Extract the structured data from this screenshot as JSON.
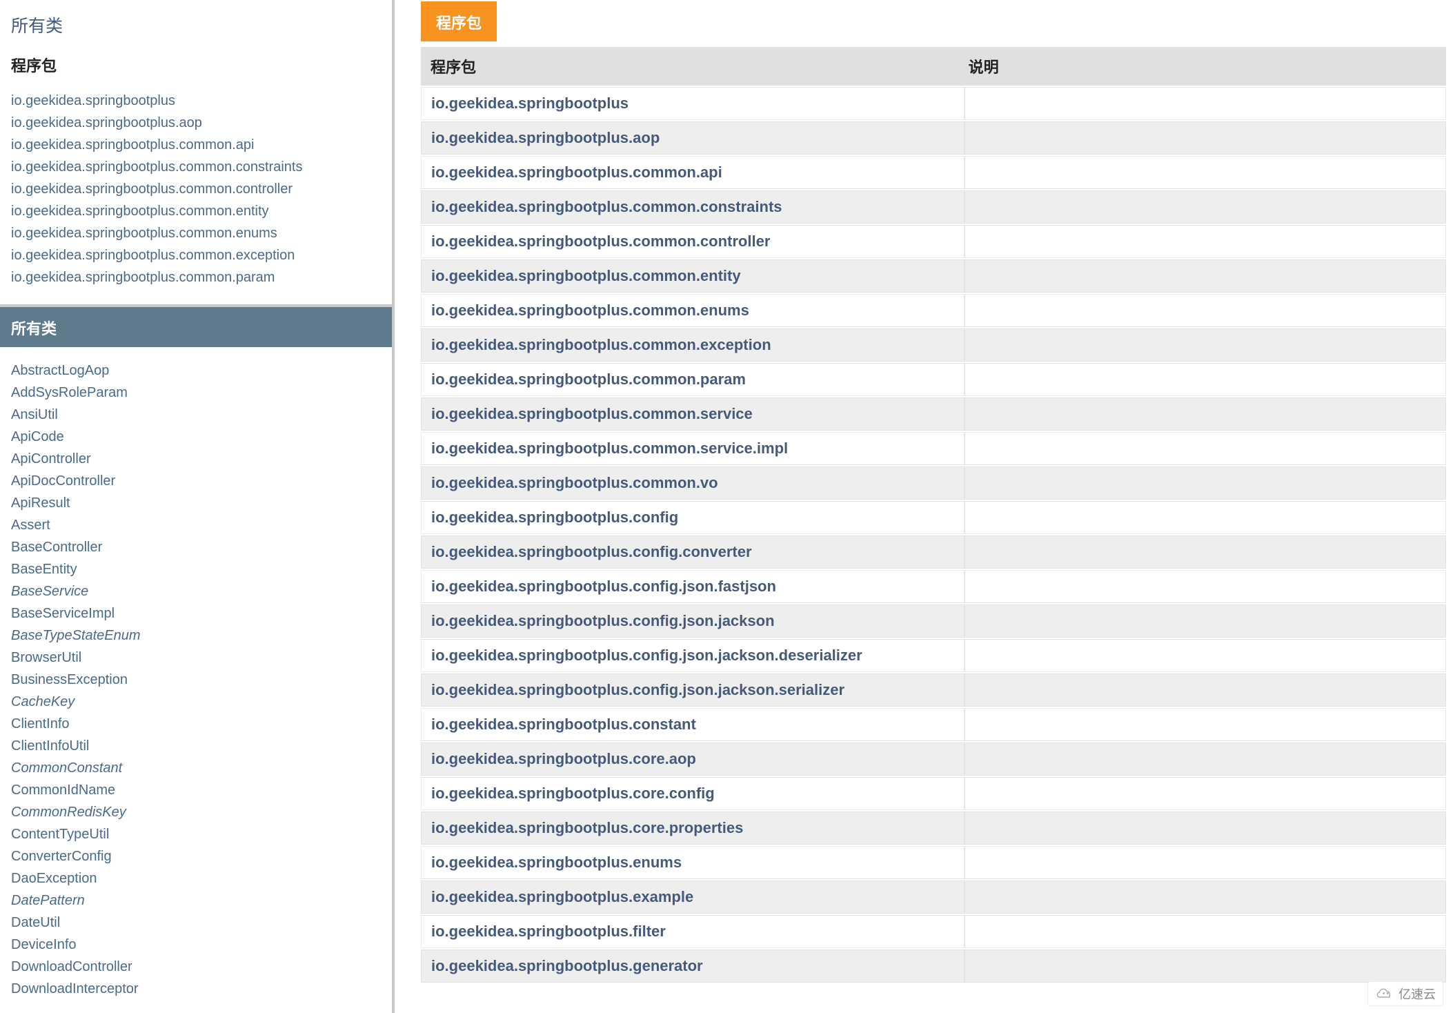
{
  "sidebar": {
    "all_classes_link": "所有类",
    "packages_heading": "程序包",
    "packages": [
      "io.geekidea.springbootplus",
      "io.geekidea.springbootplus.aop",
      "io.geekidea.springbootplus.common.api",
      "io.geekidea.springbootplus.common.constraints",
      "io.geekidea.springbootplus.common.controller",
      "io.geekidea.springbootplus.common.entity",
      "io.geekidea.springbootplus.common.enums",
      "io.geekidea.springbootplus.common.exception",
      "io.geekidea.springbootplus.common.param"
    ],
    "all_classes_bar": "所有类",
    "classes": [
      {
        "name": "AbstractLogAop",
        "italic": false
      },
      {
        "name": "AddSysRoleParam",
        "italic": false
      },
      {
        "name": "AnsiUtil",
        "italic": false
      },
      {
        "name": "ApiCode",
        "italic": false
      },
      {
        "name": "ApiController",
        "italic": false
      },
      {
        "name": "ApiDocController",
        "italic": false
      },
      {
        "name": "ApiResult",
        "italic": false
      },
      {
        "name": "Assert",
        "italic": false
      },
      {
        "name": "BaseController",
        "italic": false
      },
      {
        "name": "BaseEntity",
        "italic": false
      },
      {
        "name": "BaseService",
        "italic": true
      },
      {
        "name": "BaseServiceImpl",
        "italic": false
      },
      {
        "name": "BaseTypeStateEnum",
        "italic": true
      },
      {
        "name": "BrowserUtil",
        "italic": false
      },
      {
        "name": "BusinessException",
        "italic": false
      },
      {
        "name": "CacheKey",
        "italic": true
      },
      {
        "name": "ClientInfo",
        "italic": false
      },
      {
        "name": "ClientInfoUtil",
        "italic": false
      },
      {
        "name": "CommonConstant",
        "italic": true
      },
      {
        "name": "CommonIdName",
        "italic": false
      },
      {
        "name": "CommonRedisKey",
        "italic": true
      },
      {
        "name": "ContentTypeUtil",
        "italic": false
      },
      {
        "name": "ConverterConfig",
        "italic": false
      },
      {
        "name": "DaoException",
        "italic": false
      },
      {
        "name": "DatePattern",
        "italic": true
      },
      {
        "name": "DateUtil",
        "italic": false
      },
      {
        "name": "DeviceInfo",
        "italic": false
      },
      {
        "name": "DownloadController",
        "italic": false
      },
      {
        "name": "DownloadInterceptor",
        "italic": false
      }
    ]
  },
  "main": {
    "active_tab": "程序包",
    "columns": {
      "package": "程序包",
      "description": "说明"
    },
    "package_rows": [
      "io.geekidea.springbootplus",
      "io.geekidea.springbootplus.aop",
      "io.geekidea.springbootplus.common.api",
      "io.geekidea.springbootplus.common.constraints",
      "io.geekidea.springbootplus.common.controller",
      "io.geekidea.springbootplus.common.entity",
      "io.geekidea.springbootplus.common.enums",
      "io.geekidea.springbootplus.common.exception",
      "io.geekidea.springbootplus.common.param",
      "io.geekidea.springbootplus.common.service",
      "io.geekidea.springbootplus.common.service.impl",
      "io.geekidea.springbootplus.common.vo",
      "io.geekidea.springbootplus.config",
      "io.geekidea.springbootplus.config.converter",
      "io.geekidea.springbootplus.config.json.fastjson",
      "io.geekidea.springbootplus.config.json.jackson",
      "io.geekidea.springbootplus.config.json.jackson.deserializer",
      "io.geekidea.springbootplus.config.json.jackson.serializer",
      "io.geekidea.springbootplus.constant",
      "io.geekidea.springbootplus.core.aop",
      "io.geekidea.springbootplus.core.config",
      "io.geekidea.springbootplus.core.properties",
      "io.geekidea.springbootplus.enums",
      "io.geekidea.springbootplus.example",
      "io.geekidea.springbootplus.filter",
      "io.geekidea.springbootplus.generator"
    ]
  },
  "watermark": {
    "text": "亿速云"
  }
}
